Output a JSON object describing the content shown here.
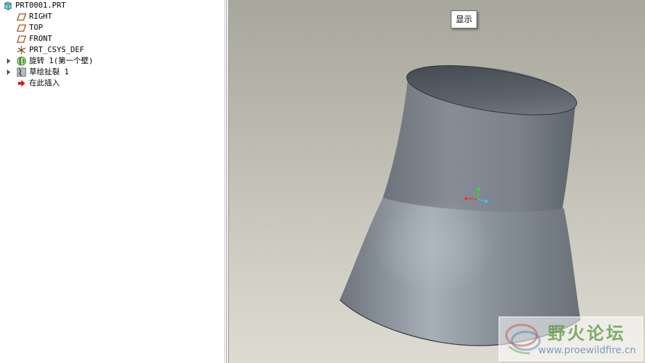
{
  "model_tree": {
    "items": [
      {
        "label": "PRT0001.PRT",
        "icon": "part-icon"
      },
      {
        "label": "RIGHT",
        "icon": "datum-plane-icon"
      },
      {
        "label": "TOP",
        "icon": "datum-plane-icon"
      },
      {
        "label": "FRONT",
        "icon": "datum-plane-icon"
      },
      {
        "label": "PRT_CSYS_DEF",
        "icon": "coordinate-system-icon"
      },
      {
        "label": "旋转 1(第一个壁)",
        "icon": "revolve-feature-icon",
        "expandable": true
      },
      {
        "label": "草绘扯裂 1",
        "icon": "sketch-rip-icon",
        "expandable": true
      },
      {
        "label": "在此插入",
        "icon": "insert-here-arrow-icon"
      }
    ]
  },
  "viewport": {
    "tooltip": "显示",
    "background_colors": [
      "#a8a79c",
      "#dedcd2"
    ],
    "model_color": "#8a9098",
    "csys_colors": {
      "x": "#ff3030",
      "y": "#30dd30",
      "z": "#30c8ff"
    }
  },
  "watermark": {
    "title": "野火论坛",
    "url": "www.proewildfire.cn"
  }
}
